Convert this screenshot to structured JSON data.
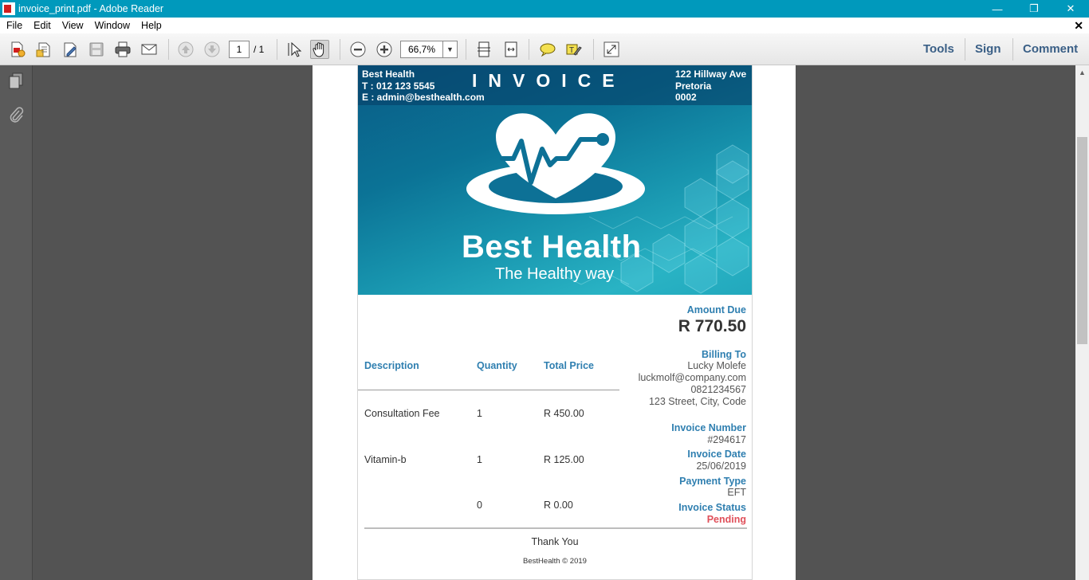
{
  "window": {
    "title": "invoice_print.pdf - Adobe Reader",
    "minimize": "—",
    "maximize": "❐",
    "close": "✕"
  },
  "menu": {
    "items": [
      "File",
      "Edit",
      "View",
      "Window",
      "Help"
    ],
    "close": "✕"
  },
  "toolbar": {
    "page_current": "1",
    "page_total": "/ 1",
    "zoom": "66,7%",
    "tools": "Tools",
    "sign": "Sign",
    "comment": "Comment"
  },
  "invoice": {
    "header": {
      "company_lines": [
        "Best Health",
        "T : 012 123 5545",
        "E : admin@besthealth.com"
      ],
      "title": "INVOICE",
      "address_lines": [
        "122 Hillway Ave",
        "Pretoria",
        "0002"
      ]
    },
    "brand": {
      "name": "Best Health",
      "tagline": "The Healthy way"
    },
    "amount_due_label": "Amount Due",
    "amount_due": "R 770.50",
    "columns": [
      "Description",
      "Quantity",
      "Total Price"
    ],
    "rows": [
      {
        "description": "Consultation Fee",
        "quantity": "1",
        "price": "R 450.00"
      },
      {
        "description": "Vitamin-b",
        "quantity": "1",
        "price": "R 125.00"
      },
      {
        "description": "",
        "quantity": "0",
        "price": "R 0.00"
      }
    ],
    "billing": {
      "label": "Billing To",
      "lines": [
        "Lucky Molefe",
        "luckmolf@company.com",
        "0821234567",
        "123 Street, City, Code"
      ]
    },
    "invoice_number_label": "Invoice Number",
    "invoice_number": "#294617",
    "invoice_date_label": "Invoice Date",
    "invoice_date": "25/06/2019",
    "payment_type_label": "Payment Type",
    "payment_type": "EFT",
    "invoice_status_label": "Invoice Status",
    "invoice_status": "Pending",
    "thanks": "Thank You",
    "copyright": "BestHealth © 2019"
  },
  "colors": {
    "titlebar": "#0099bc",
    "accent": "#2f7fb0",
    "pending": "#e0505a",
    "doc_bg": "#535353"
  }
}
